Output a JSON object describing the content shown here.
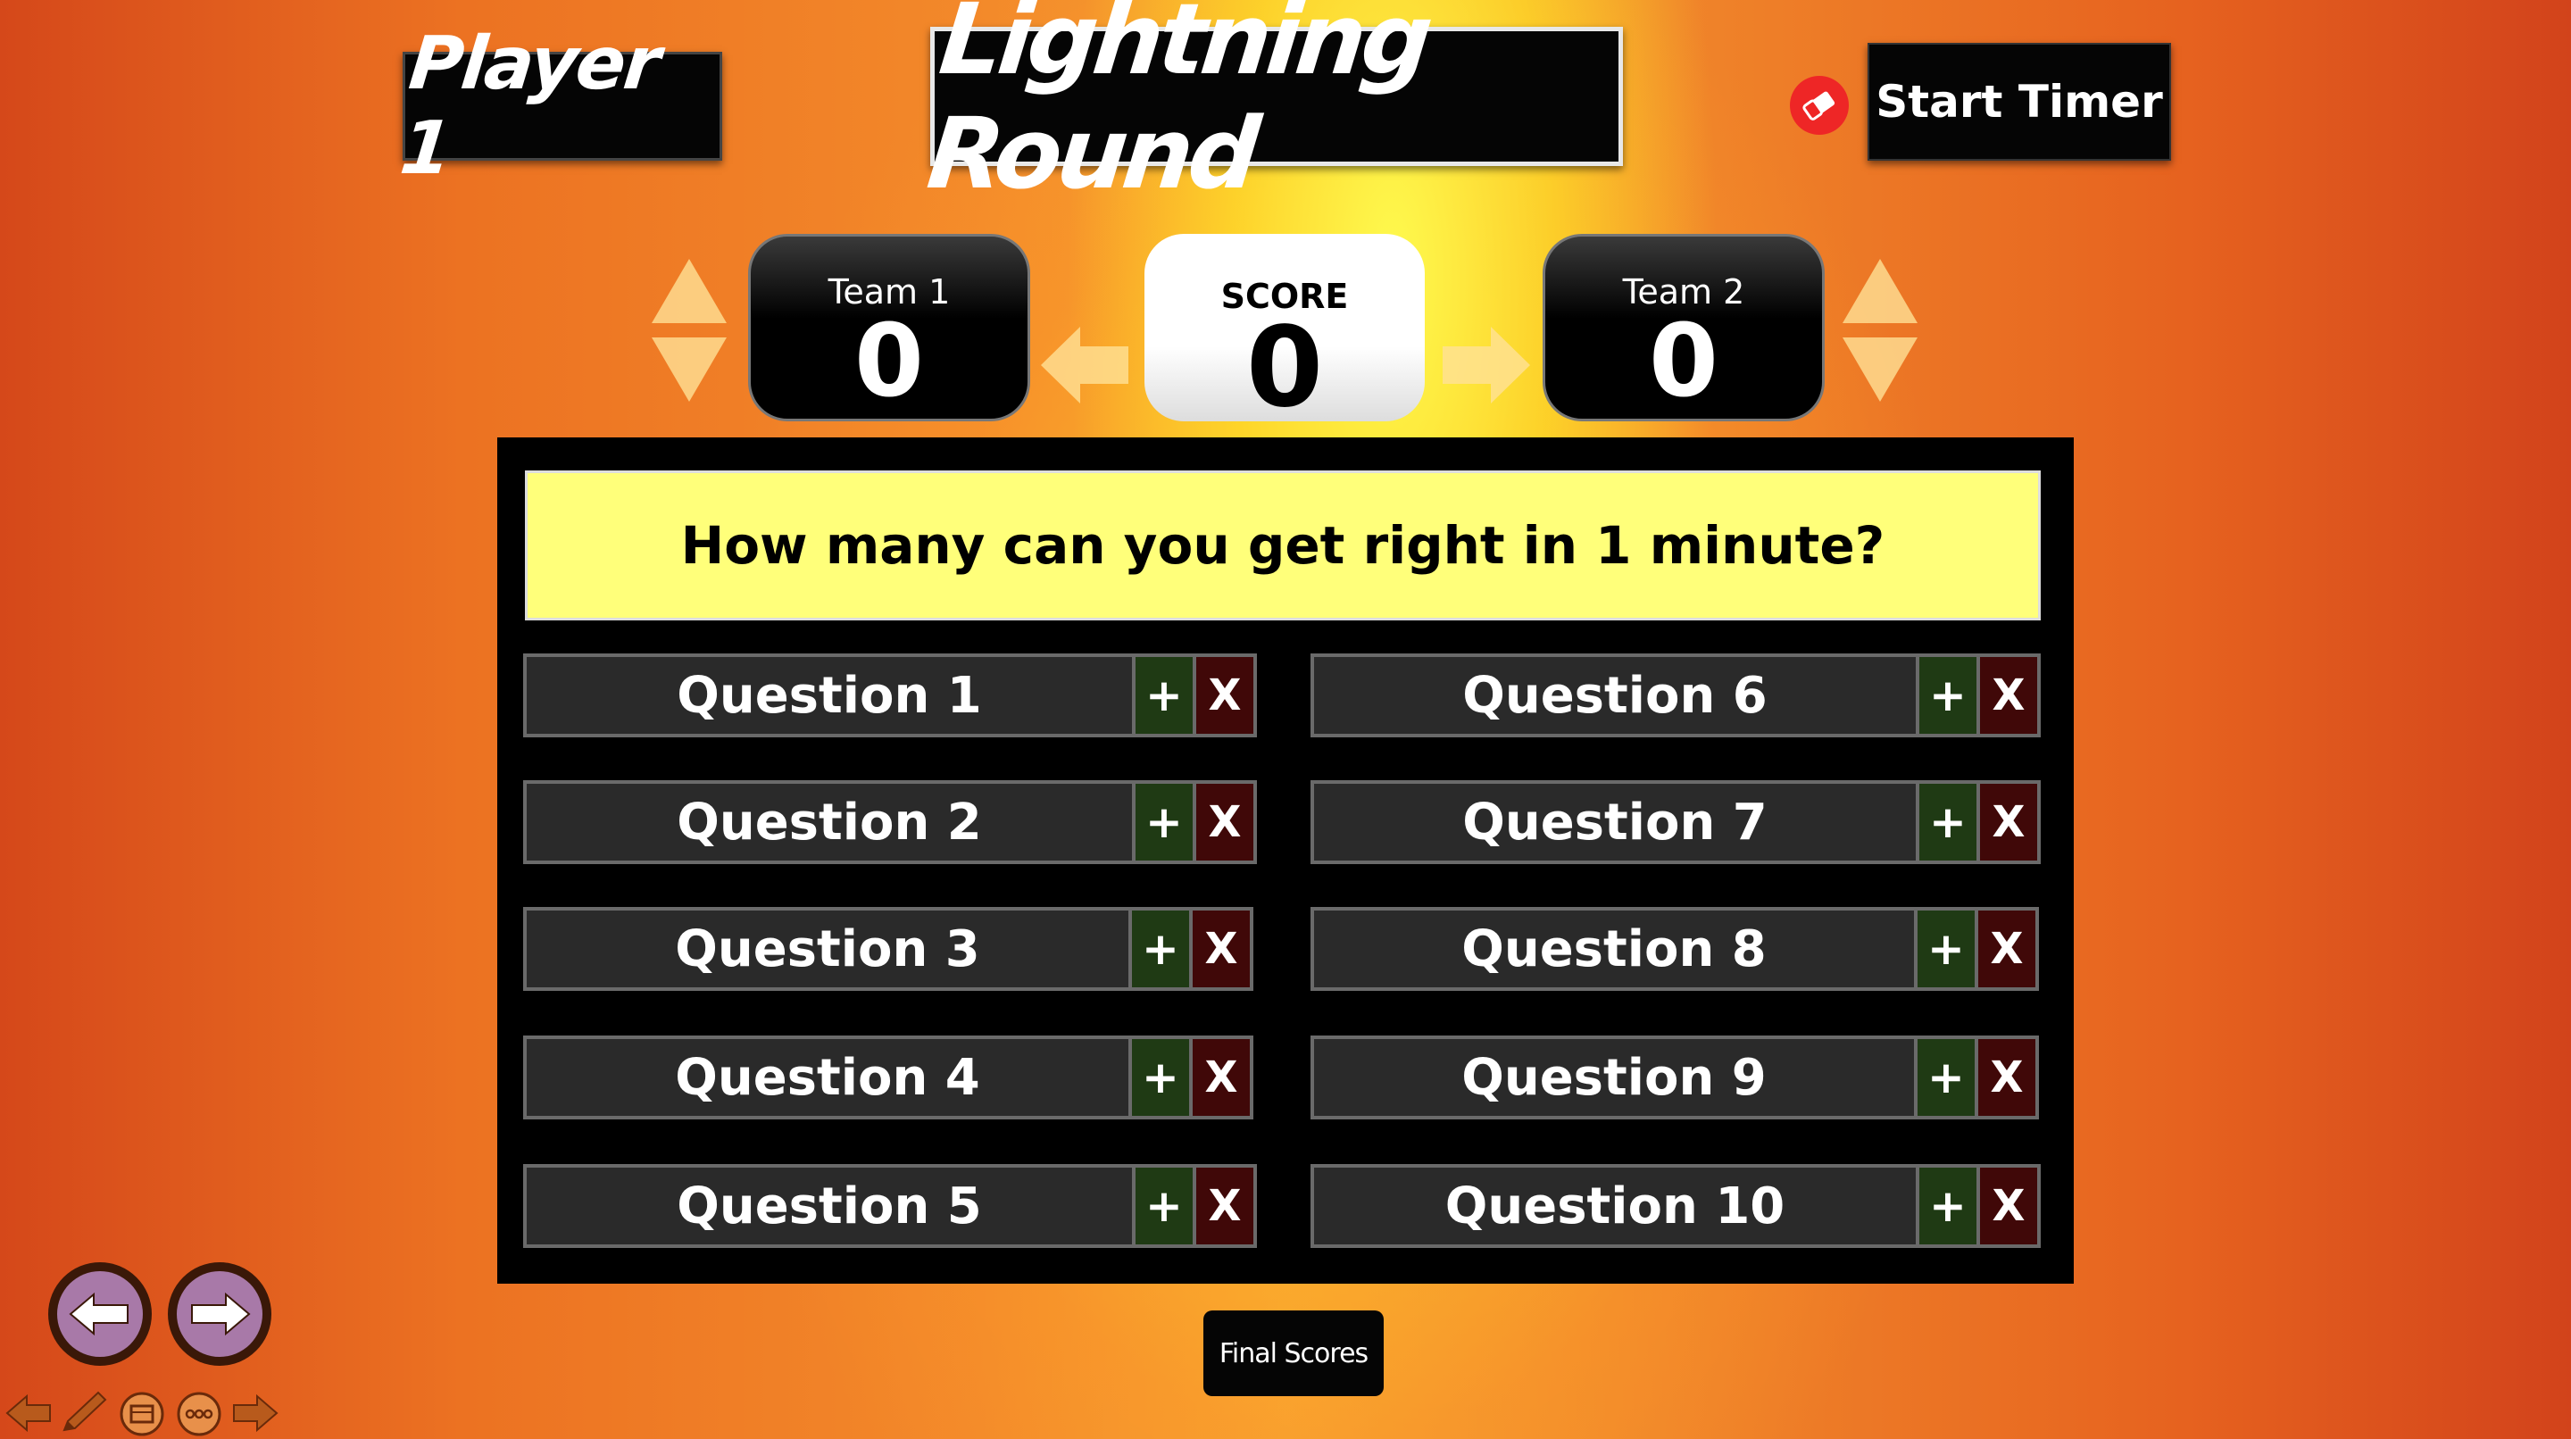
{
  "header": {
    "player_label": "Player 1",
    "title": "Lightning Round",
    "timer_button": "Start Timer"
  },
  "scoreboard": {
    "team1": {
      "label": "Team 1",
      "score": "0"
    },
    "center": {
      "label": "SCORE",
      "score": "0"
    },
    "team2": {
      "label": "Team 2",
      "score": "0"
    }
  },
  "board": {
    "prompt": "How many can you get right in 1 minute?",
    "plus_symbol": "+",
    "x_symbol": "X",
    "questions": [
      "Question 1",
      "Question 2",
      "Question 3",
      "Question 4",
      "Question 5",
      "Question 6",
      "Question 7",
      "Question 8",
      "Question 9",
      "Question 10"
    ]
  },
  "footer": {
    "final_scores_button": "Final Scores"
  },
  "icons": {
    "eraser": "eraser-icon",
    "prev_slide": "arrow-left-icon",
    "next_slide": "arrow-right-icon",
    "toolbar": [
      "back-arrow-icon",
      "pen-icon",
      "slides-icon",
      "more-icon",
      "forward-arrow-icon"
    ]
  },
  "colors": {
    "board_bg": "#000000",
    "banner_bg": "#ffff7a",
    "plus_bg": "#1f3a14",
    "x_bg": "#400808",
    "eraser_red": "#ee2626",
    "nav_purple": "#a879a8"
  }
}
